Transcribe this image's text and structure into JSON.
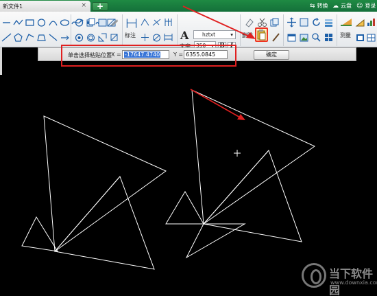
{
  "tab_bar": {
    "document_tab": "新文件1",
    "close_glyph": "×",
    "new_tab": "+",
    "convert_label": "转换",
    "cloud_label": "云盘",
    "account_label": "登录"
  },
  "ribbon": {
    "dimension_label": "标注",
    "text_label": "文字",
    "text_glyph": "A",
    "font_name": "hztxt",
    "font_size": "350",
    "bold": "B",
    "italic": "I",
    "delete_label": "删除",
    "measure_label": "测量"
  },
  "coord_bar": {
    "prompt": "单击选择粘贴位置",
    "x_label": "X =",
    "x_value": "-17647.4740",
    "y_label": "Y =",
    "y_value": "6355.0845",
    "confirm": "确定"
  },
  "canvas": {
    "cursor": "+",
    "background": "#000000",
    "stroke": "#ffffff"
  },
  "annotation": {
    "color": "#e02020"
  },
  "watermark": {
    "title": "当下软件园",
    "url": "www.downxia.com"
  }
}
